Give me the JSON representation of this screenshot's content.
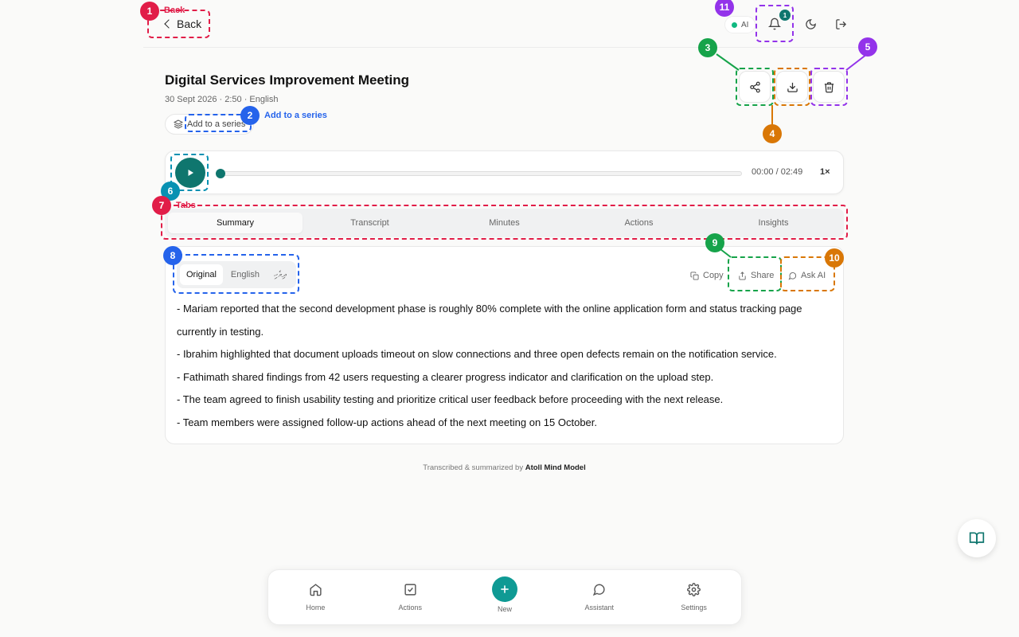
{
  "header": {
    "back_label": "Back",
    "ai_status_label": "AI",
    "notification_count": "1"
  },
  "meeting": {
    "title": "Digital Services Improvement Meeting",
    "meta": "30 Sept 2026 · 2:50 · English",
    "series_button_label": "Add to a series"
  },
  "player": {
    "time": "00:00 / 02:49",
    "speed": "1×",
    "progress": 0
  },
  "tabs": [
    {
      "label": "Summary",
      "active": true
    },
    {
      "label": "Transcript",
      "active": false
    },
    {
      "label": "Minutes",
      "active": false
    },
    {
      "label": "Actions",
      "active": false
    },
    {
      "label": "Insights",
      "active": false
    }
  ],
  "language_toggle": [
    {
      "label": "Original",
      "active": true
    },
    {
      "label": "English",
      "active": false
    },
    {
      "label": "ދިވެހި",
      "active": false
    }
  ],
  "summary_tools": {
    "copy_label": "Copy",
    "share_label": "Share",
    "ask_ai_label": "Ask AI"
  },
  "summary_bullets": [
    "- Mariam reported that the second development phase is roughly 80% complete with the online application form and status tracking page currently in testing.",
    "- Ibrahim highlighted that document uploads timeout on slow connections and three open defects remain on the notification service.",
    "- Fathimath shared findings from 42 users requesting a clearer progress indicator and clarification on the upload step.",
    "- The team agreed to finish usability testing and prioritize critical user feedback before proceeding with the next release.",
    "- Team members were assigned follow-up actions ahead of the next meeting on 15 October."
  ],
  "footer": {
    "prefix": "Transcribed & summarized by",
    "model": "Atoll Mind Model"
  },
  "bottom_nav": [
    {
      "label": "Home",
      "icon": "home-icon"
    },
    {
      "label": "Actions",
      "icon": "checkbox-icon"
    },
    {
      "label": "New",
      "icon": "plus-icon"
    },
    {
      "label": "Assistant",
      "icon": "chat-icon"
    },
    {
      "label": "Settings",
      "icon": "gear-icon"
    }
  ],
  "annotations": {
    "n1": "1",
    "l1": "Back",
    "n2": "2",
    "l2": "Add to a series",
    "n3": "3",
    "n4": "4",
    "n5": "5",
    "n6": "6",
    "n7": "7",
    "l7": "Tabs",
    "n8": "8",
    "n9": "9",
    "n10": "10",
    "n11": "11"
  },
  "colors": {
    "accent": "#0f766e",
    "annotation_red": "#e11d48",
    "annotation_blue": "#2563eb",
    "annotation_green": "#16a34a",
    "annotation_orange": "#d97706",
    "annotation_purple": "#9333ea",
    "annotation_teal": "#0891b2"
  }
}
